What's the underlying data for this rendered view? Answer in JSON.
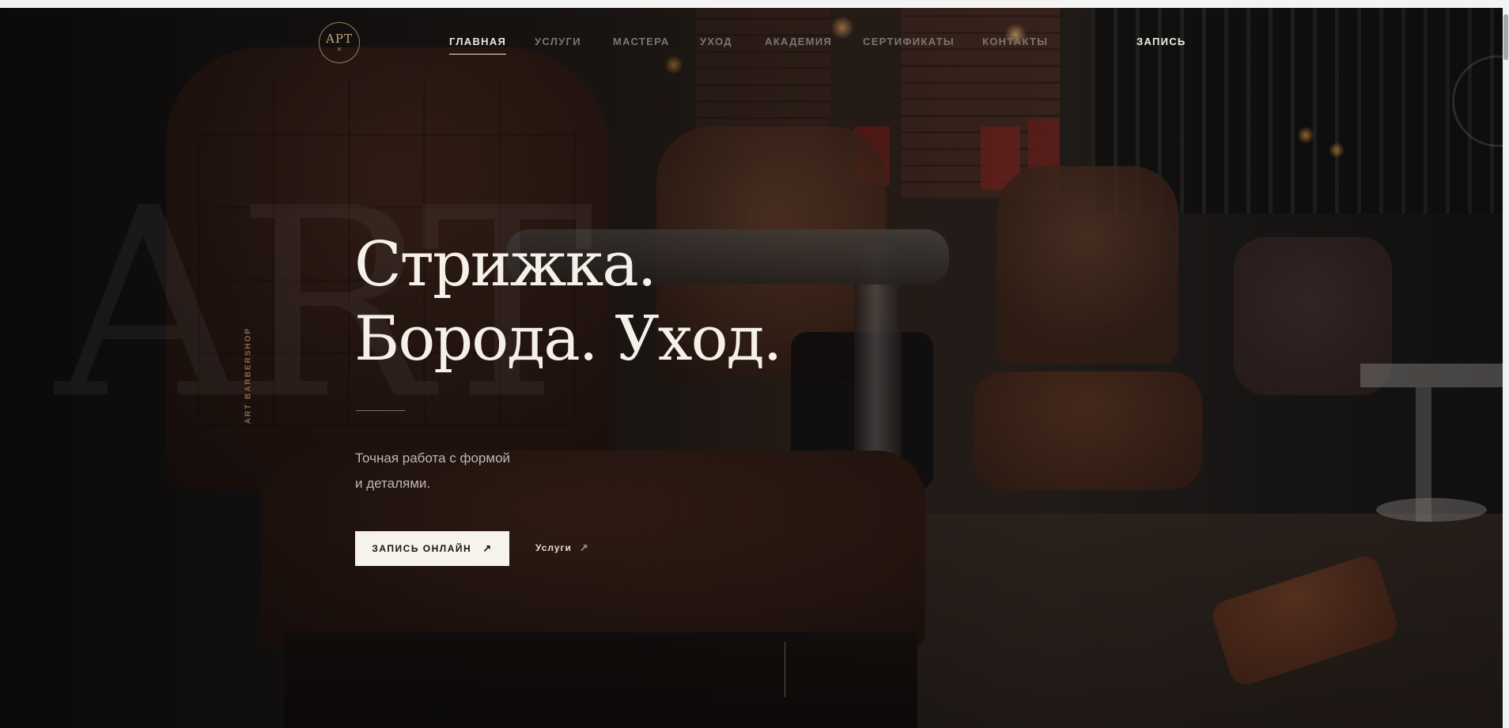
{
  "header": {
    "logo_text": "APT",
    "logo_mark": "✕",
    "nav": [
      {
        "label": "ГЛАВНАЯ",
        "active": true
      },
      {
        "label": "УСЛУГИ",
        "active": false
      },
      {
        "label": "МАСТЕРА",
        "active": false
      },
      {
        "label": "УХОД",
        "active": false
      },
      {
        "label": "АКАДЕМИЯ",
        "active": false
      },
      {
        "label": "СЕРТИФИКАТЫ",
        "active": false
      },
      {
        "label": "КОНТАКТЫ",
        "active": false
      }
    ],
    "cta_label": "ЗАПИСЬ"
  },
  "hero": {
    "side_label": "ART BARBERSHOP",
    "watermark": "ART",
    "headline_line1": "Стрижка.",
    "headline_line2": "Борода. Уход.",
    "lead_line1": "Точная работа с формой",
    "lead_line2": "и деталями.",
    "primary_button": {
      "label": "ЗАПИСЬ ОНЛАЙН",
      "icon": "arrow-up-right-icon",
      "glyph": "↗"
    },
    "secondary_link": {
      "label": "Услуги",
      "icon": "arrow-up-right-icon",
      "glyph": "↗"
    }
  },
  "colors": {
    "accent_gold": "#c2a37a",
    "text_light": "#f5f0e8",
    "button_bg": "#f6f2ec"
  }
}
